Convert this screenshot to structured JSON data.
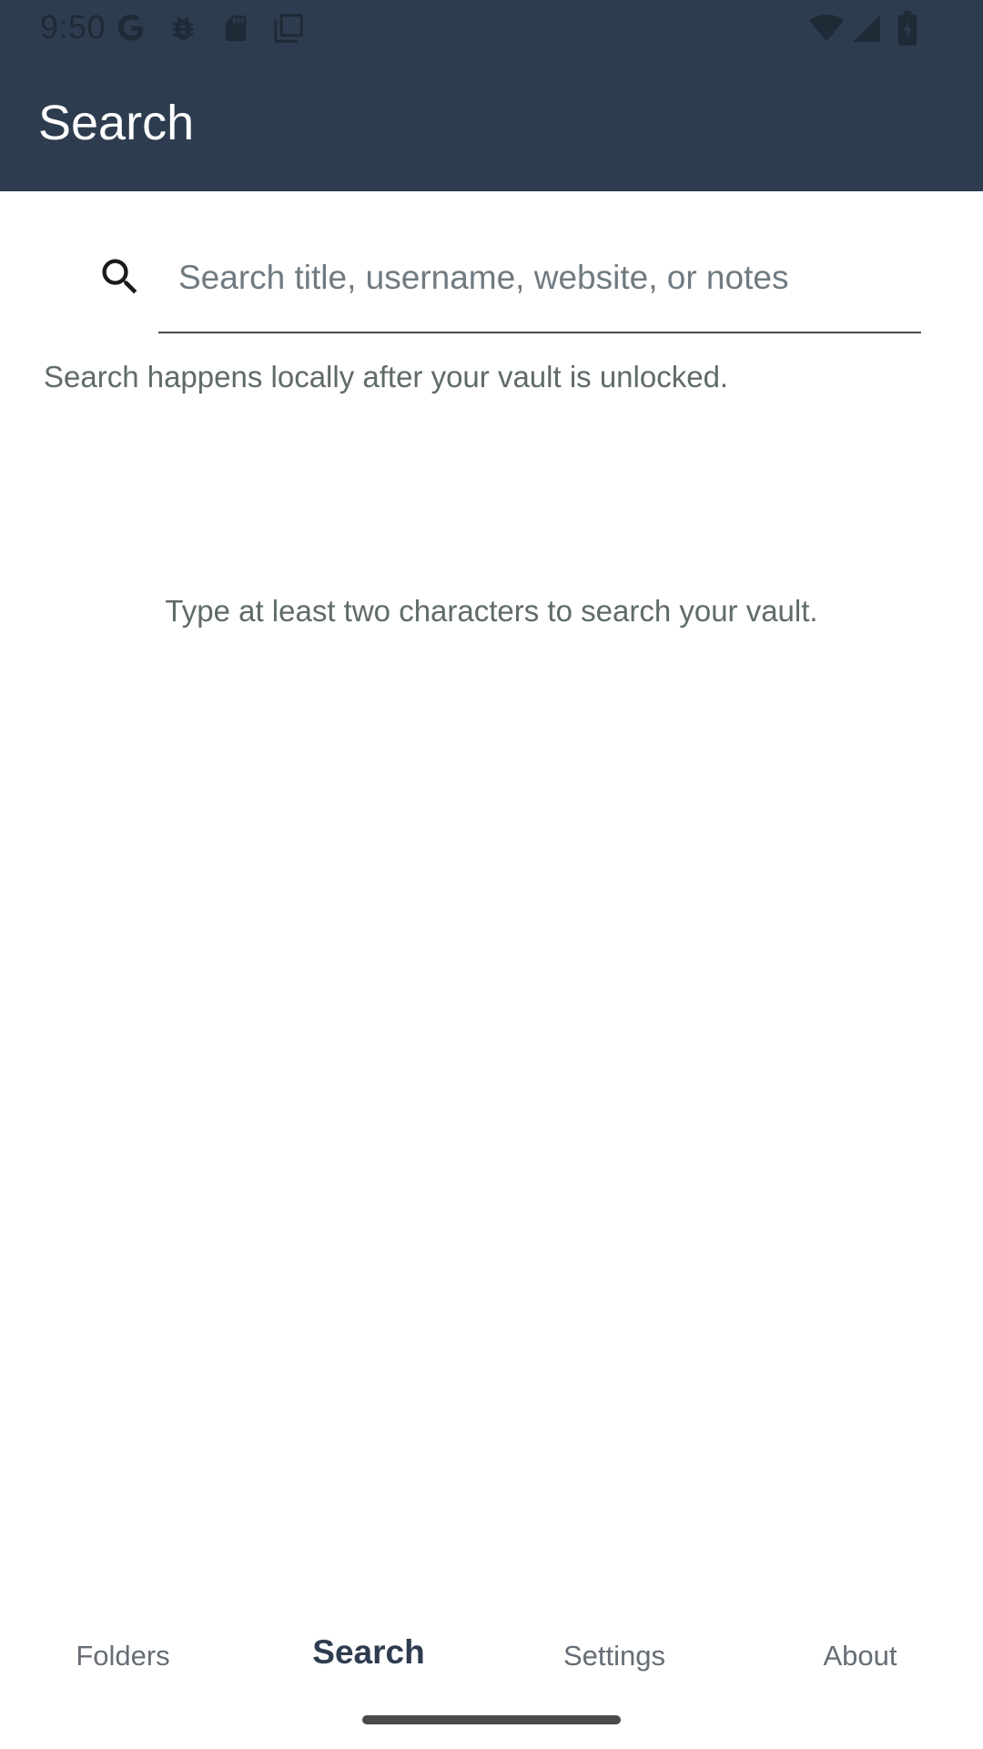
{
  "status_bar": {
    "time": "9:50",
    "icons": [
      "google-icon",
      "bug-icon",
      "sd-card-icon",
      "copy-icon",
      "wifi-icon",
      "signal-icon",
      "battery-charging-icon"
    ]
  },
  "app_bar": {
    "title": "Search"
  },
  "search": {
    "placeholder": "Search title, username, website, or notes",
    "value": "",
    "icon": "search-icon"
  },
  "hint": "Search happens locally after your vault is unlocked.",
  "empty_state": "Type at least two characters to search your vault.",
  "bottom_nav": {
    "items": [
      {
        "label": "Folders",
        "active": false
      },
      {
        "label": "Search",
        "active": true
      },
      {
        "label": "Settings",
        "active": false
      },
      {
        "label": "About",
        "active": false
      }
    ]
  },
  "colors": {
    "app_bar": "#2e3c4f",
    "secondary_text": "#5f6b68",
    "nav_inactive": "#666d75"
  }
}
